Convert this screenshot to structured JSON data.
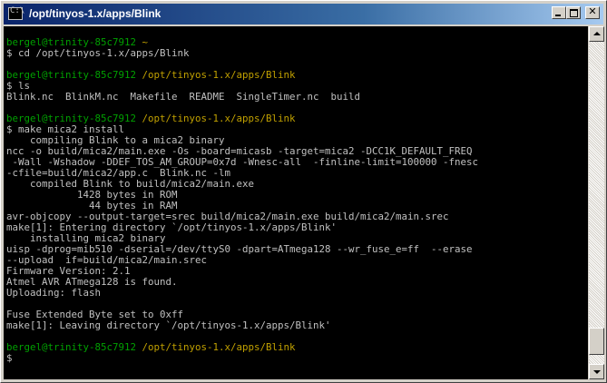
{
  "window": {
    "title": "/opt/tinyos-1.x/apps/Blink",
    "icon": "console-icon",
    "icon_glyph": "C:\\",
    "buttons": {
      "minimize": "minimize-icon",
      "maximize": "maximize-icon",
      "close": "close-icon",
      "close_glyph": "✕"
    }
  },
  "terminal": {
    "colors": {
      "background": "#000000",
      "text": "#c0c0c0",
      "prompt_user": "#00a000",
      "prompt_path": "#c0a000"
    },
    "lines": [
      {
        "text": ""
      },
      {
        "user": "bergel@trinity-85c7912",
        "path": " ~"
      },
      {
        "text": "$ cd /opt/tinyos-1.x/apps/Blink"
      },
      {
        "text": ""
      },
      {
        "user": "bergel@trinity-85c7912",
        "path": " /opt/tinyos-1.x/apps/Blink"
      },
      {
        "text": "$ ls"
      },
      {
        "text": "Blink.nc  BlinkM.nc  Makefile  README  SingleTimer.nc  build"
      },
      {
        "text": ""
      },
      {
        "user": "bergel@trinity-85c7912",
        "path": " /opt/tinyos-1.x/apps/Blink"
      },
      {
        "text": "$ make mica2 install"
      },
      {
        "text": "    compiling Blink to a mica2 binary"
      },
      {
        "text": "ncc -o build/mica2/main.exe -Os -board=micasb -target=mica2 -DCC1K_DEFAULT_FREQ"
      },
      {
        "text": " -Wall -Wshadow -DDEF_TOS_AM_GROUP=0x7d -Wnesc-all  -finline-limit=100000 -fnesc"
      },
      {
        "text": "-cfile=build/mica2/app.c  Blink.nc -lm"
      },
      {
        "text": "    compiled Blink to build/mica2/main.exe"
      },
      {
        "text": "            1428 bytes in ROM"
      },
      {
        "text": "              44 bytes in RAM"
      },
      {
        "text": "avr-objcopy --output-target=srec build/mica2/main.exe build/mica2/main.srec"
      },
      {
        "text": "make[1]: Entering directory `/opt/tinyos-1.x/apps/Blink'"
      },
      {
        "text": "    installing mica2 binary"
      },
      {
        "text": "uisp -dprog=mib510 -dserial=/dev/ttyS0 -dpart=ATmega128 --wr_fuse_e=ff  --erase"
      },
      {
        "text": "--upload  if=build/mica2/main.srec"
      },
      {
        "text": "Firmware Version: 2.1"
      },
      {
        "text": "Atmel AVR ATmega128 is found."
      },
      {
        "text": "Uploading: flash"
      },
      {
        "text": ""
      },
      {
        "text": "Fuse Extended Byte set to 0xff"
      },
      {
        "text": "make[1]: Leaving directory `/opt/tinyos-1.x/apps/Blink'"
      },
      {
        "text": ""
      },
      {
        "user": "bergel@trinity-85c7912",
        "path": " /opt/tinyos-1.x/apps/Blink"
      },
      {
        "text": "$"
      }
    ]
  },
  "scrollbar": {
    "position_fraction": 0.97,
    "up_icon": "scroll-up-arrow-icon",
    "down_icon": "scroll-down-arrow-icon"
  }
}
